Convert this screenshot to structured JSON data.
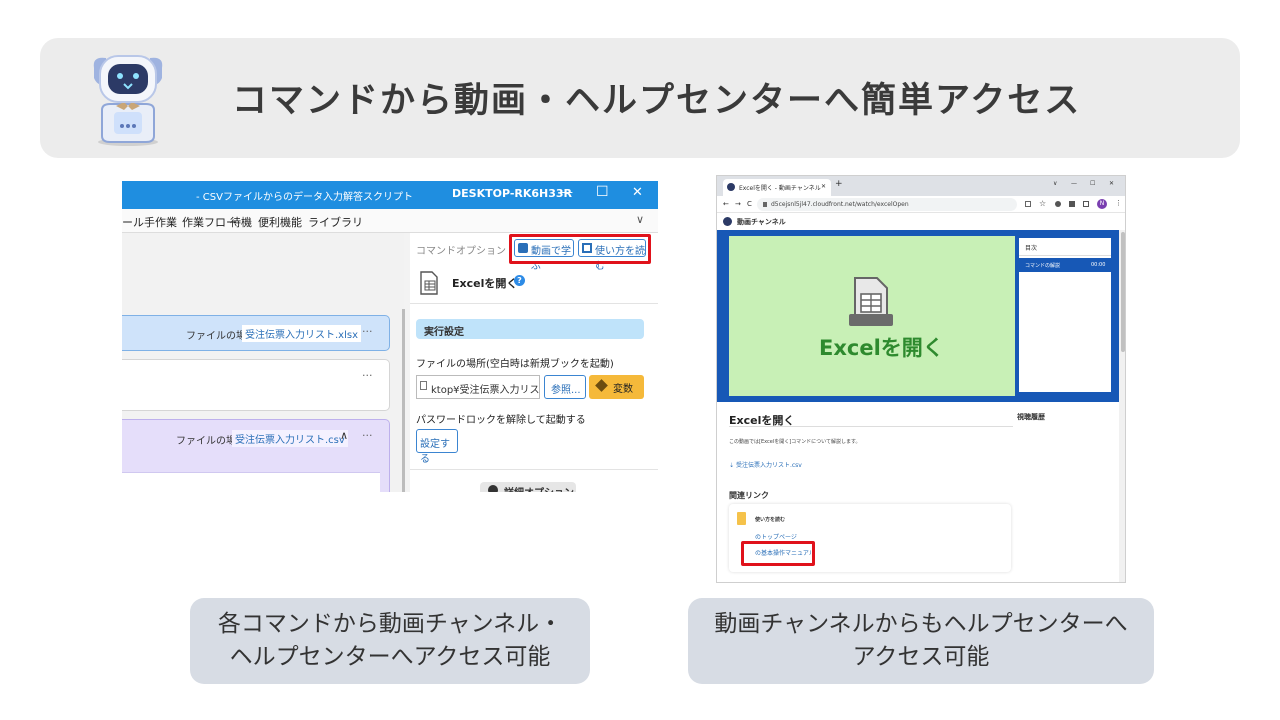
{
  "header": {
    "title": "コマンドから動画・ヘルプセンターへ簡単アクセス"
  },
  "left_shot": {
    "window_title": "- CSVファイルからのデータ入力解答スクリプト",
    "machine": "DESKTOP-RK6H33R",
    "window_controls": [
      "—",
      "☐",
      "✕"
    ],
    "menu": [
      "ール",
      "手作業",
      "作業フロー",
      "待機",
      "便利機能",
      "ライブラリ"
    ],
    "menu_chevron": "∨",
    "cmd_option_label": "コマンドオプション",
    "video_btn": "動画で学ぶ",
    "manual_btn": "使い方を読む",
    "command_name": "Excelを開く",
    "help_mark": "?",
    "section_exec": "実行設定",
    "file_loc_label": "ファイルの場所(空白時は新規ブックを起動)",
    "file_input_value": "ktop¥受注伝票入力リス",
    "browse_btn": "参照...",
    "var_btn": "変数",
    "pw_label": "パスワードロックを解除して起動する",
    "settings_btn": "設定する",
    "detail_options": "詳細オプション",
    "card1_label": "ファイルの場所",
    "card1_value": "受注伝票入力リスト.xlsx",
    "card3_label": "ファイルの場所",
    "card3_value": "受注伝票入力リスト.csv",
    "more": "···",
    "caret_up": "∧"
  },
  "right_shot": {
    "tab_title": "Excelを開く - 動画チャンネル",
    "tab_close": "✕",
    "new_tab": "+",
    "window_controls": [
      "∨",
      "—",
      "☐",
      "✕"
    ],
    "nav": [
      "←",
      "→",
      "C"
    ],
    "url": "d5cejsnl5jl47.cloudfront.net/watch/excelOpen",
    "avatar_letter": "N",
    "site_name": "動画チャンネル",
    "video_caption": "Excelを開く",
    "toc_title": "目次",
    "toc_item": "コマンドの解説",
    "toc_time": "00:00",
    "page_title": "Excelを開く",
    "history_title": "視聴履歴",
    "description": "この動画では[Excelを開く]コマンドについて解説します。",
    "download_link": "受注伝票入力リスト.csv",
    "related_title": "関連リンク",
    "related_card_title": "使い方を読む",
    "related_link1": "のトップページ",
    "related_link2": "の基本操作マニュアル"
  },
  "captions": {
    "left_line1": "各コマンドから動画チャンネル・",
    "left_line2": "ヘルプセンターへアクセス可能",
    "right_line1": "動画チャンネルからもヘルプセンターへ",
    "right_line2": "アクセス可能"
  },
  "colors": {
    "accent_blue": "#1f8ee0",
    "highlight_red": "#e0121b",
    "exec_section": "#bfe3fa",
    "var_button": "#f5b93a",
    "video_green": "#c8f0b6",
    "video_text": "#2e8a2e",
    "hero_blue": "#1758b6",
    "caption_bg": "#d7dce4",
    "banner_bg": "#ececec"
  }
}
